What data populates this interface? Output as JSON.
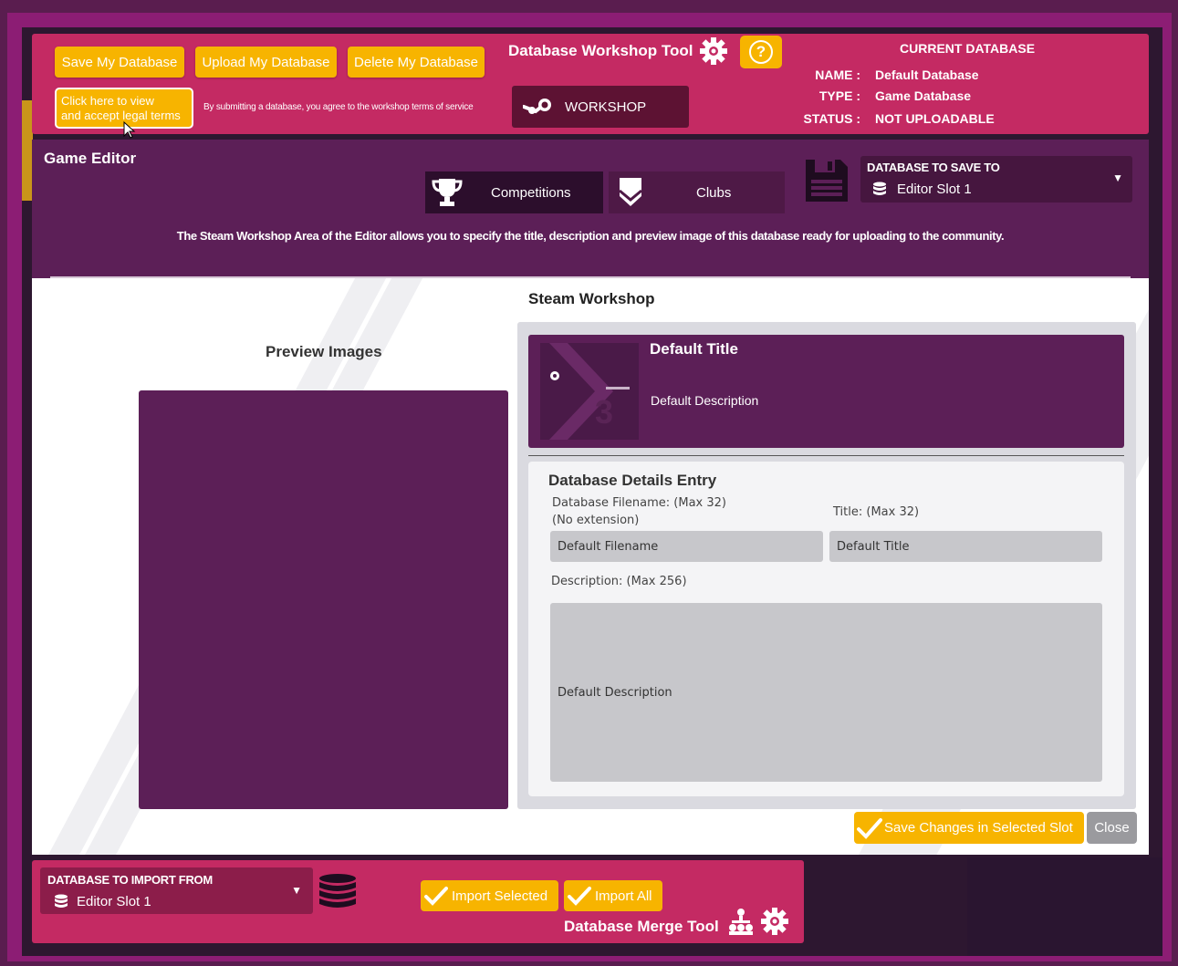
{
  "top_bar": {
    "save_label": "Save My Database",
    "upload_label": "Upload My Database",
    "delete_label": "Delete My Database",
    "legal_line1": "Click here to view",
    "legal_line2": "and accept legal terms",
    "terms_notice": "By submitting a database, you agree to the workshop terms of service",
    "tool_title": "Database Workshop Tool",
    "help_glyph": "?",
    "workshop_label": "WORKSHOP"
  },
  "current_database": {
    "heading": "CURRENT DATABASE",
    "name_key": "NAME :",
    "name_value": "Default Database",
    "type_key": "TYPE :",
    "type_value": "Game Database",
    "status_key": "STATUS :",
    "status_value": "NOT UPLOADABLE"
  },
  "editor": {
    "title": "Game Editor",
    "tabs": [
      {
        "label": "Competitions",
        "icon": "trophy-icon"
      },
      {
        "label": "Clubs",
        "icon": "shield-icon"
      }
    ],
    "save_to_label": "DATABASE TO SAVE TO",
    "save_to_value": "Editor Slot 1",
    "description": "The Steam Workshop Area of the Editor allows you to specify the title, description and preview image of this database ready for uploading to the community."
  },
  "workshop": {
    "title": "Steam Workshop",
    "preview_images_title": "Preview Images",
    "card_title": "Default Title",
    "card_description": "Default Description",
    "details_title": "Database Details Entry",
    "filename_label_1": "Database Filename: (Max 32)",
    "filename_label_2": "(No extension)",
    "title_label": "Title: (Max 32)",
    "filename_value": "Default Filename",
    "title_value": "Default Title",
    "description_label": "Description: (Max 256)",
    "description_value": "Default Description",
    "save_changes_label": "Save Changes in Selected Slot",
    "close_label": "Close"
  },
  "merge": {
    "import_from_label": "DATABASE TO IMPORT FROM",
    "import_from_value": "Editor Slot 1",
    "import_selected_label": "Import Selected",
    "import_all_label": "Import All",
    "tool_title": "Database Merge Tool"
  },
  "colors": {
    "accent_yellow": "#f7b400",
    "panel_pink": "#c42a63",
    "panel_purple": "#5c1f57"
  }
}
